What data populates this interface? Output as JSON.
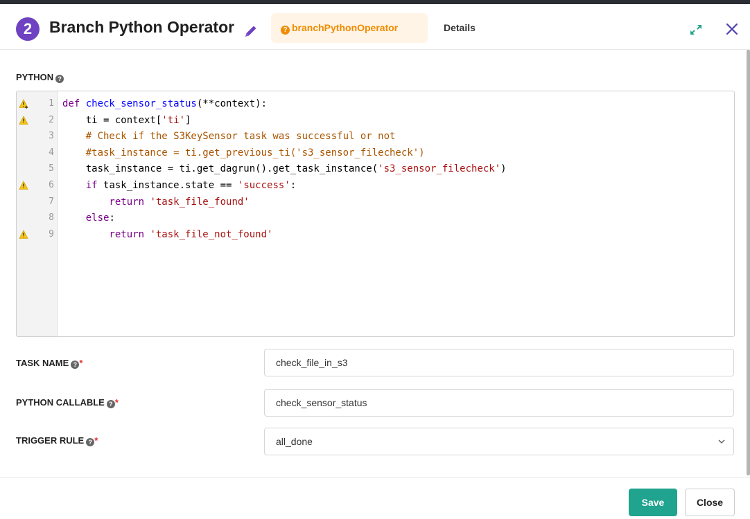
{
  "header": {
    "step_number": "2",
    "title": "Branch Python Operator",
    "tabs": [
      {
        "label": "branchPythonOperator",
        "active": true
      },
      {
        "label": "Details",
        "active": false
      }
    ]
  },
  "python_section": {
    "label": "PYTHON",
    "code_lines": [
      {
        "num": "1",
        "warn": "warning-plus",
        "tokens": [
          [
            "kw",
            "def "
          ],
          [
            "fn",
            "check_sensor_status"
          ],
          [
            "",
            "(**context):"
          ]
        ]
      },
      {
        "num": "2",
        "warn": "warning",
        "tokens": [
          [
            "",
            "    ti = context["
          ],
          [
            "str",
            "'ti'"
          ],
          [
            "",
            "]"
          ]
        ]
      },
      {
        "num": "3",
        "warn": "",
        "tokens": [
          [
            "cm",
            "    # Check if the S3KeySensor task was successful or not"
          ]
        ]
      },
      {
        "num": "4",
        "warn": "",
        "tokens": [
          [
            "cm",
            "    #task_instance = ti.get_previous_ti('s3_sensor_filecheck')"
          ]
        ]
      },
      {
        "num": "5",
        "warn": "",
        "tokens": [
          [
            "",
            "    task_instance = ti.get_dagrun().get_task_instance("
          ],
          [
            "str",
            "'s3_sensor_filecheck'"
          ],
          [
            "",
            ")"
          ]
        ]
      },
      {
        "num": "6",
        "warn": "warning",
        "tokens": [
          [
            "kw",
            "    if "
          ],
          [
            "",
            "task_instance.state == "
          ],
          [
            "str",
            "'success'"
          ],
          [
            "",
            ":"
          ]
        ]
      },
      {
        "num": "7",
        "warn": "",
        "tokens": [
          [
            "kw",
            "        return "
          ],
          [
            "str",
            "'task_file_found'"
          ]
        ]
      },
      {
        "num": "8",
        "warn": "",
        "tokens": [
          [
            "kw",
            "    else"
          ],
          [
            "",
            ":"
          ]
        ]
      },
      {
        "num": "9",
        "warn": "warning",
        "tokens": [
          [
            "kw",
            "        return "
          ],
          [
            "str",
            "'task_file_not_found'"
          ]
        ]
      }
    ]
  },
  "form": {
    "task_name": {
      "label": "TASK NAME",
      "value": "check_file_in_s3"
    },
    "python_callable": {
      "label": "PYTHON CALLABLE",
      "value": "check_sensor_status"
    },
    "trigger_rule": {
      "label": "TRIGGER RULE",
      "value": "all_done"
    }
  },
  "footer": {
    "save_label": "Save",
    "close_label": "Close"
  },
  "colors": {
    "badge": "#6f42c1",
    "operator_tab_text": "#f08c00",
    "operator_tab_bg": "#fff4e6",
    "save_button": "#20a38f",
    "warning": "#f5c518",
    "required": "#e03131"
  },
  "icons": {
    "edit": "pencil-icon",
    "help": "question-circle-icon",
    "expand": "expand-arrows-icon",
    "close": "close-x-icon",
    "warning": "warning-triangle-icon",
    "dropdown": "chevron-down-icon"
  }
}
